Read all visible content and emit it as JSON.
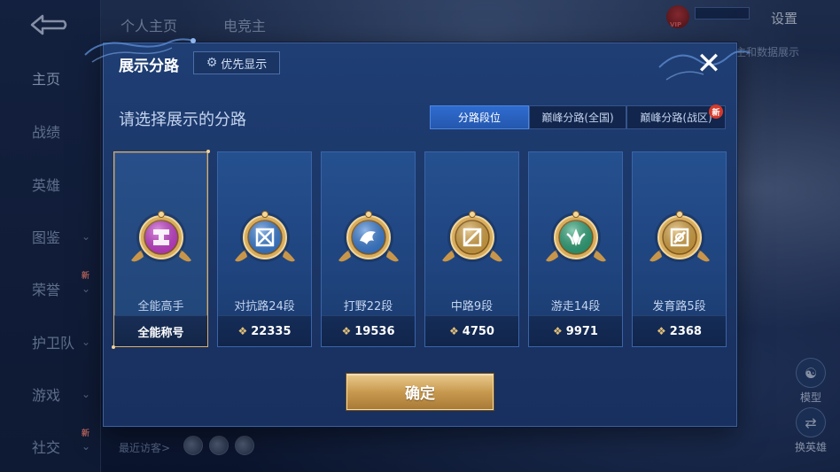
{
  "sidebar": {
    "items": [
      {
        "label": "主页",
        "chevron": false,
        "is_new": false
      },
      {
        "label": "战绩",
        "chevron": false,
        "is_new": false
      },
      {
        "label": "英雄",
        "chevron": false,
        "is_new": false
      },
      {
        "label": "图鉴",
        "chevron": true,
        "is_new": false
      },
      {
        "label": "荣誉",
        "chevron": true,
        "is_new": true
      },
      {
        "label": "护卫队",
        "chevron": true,
        "is_new": false
      },
      {
        "label": "游戏",
        "chevron": true,
        "is_new": false
      },
      {
        "label": "社交",
        "chevron": true,
        "is_new": true
      }
    ],
    "active_index": 0,
    "new_tag": "新"
  },
  "background": {
    "tab_personal": "个人主页",
    "tab_esports": "电竞主",
    "vip": "VIP",
    "settings": "设置",
    "right_text": "主和数据展示",
    "recent_visitors": "最近访客>",
    "model_label": "模型",
    "switch_hero_label": "换英雄"
  },
  "modal": {
    "title": "展示分路",
    "priority_button": "优先显示",
    "subtitle": "请选择展示的分路",
    "segments": [
      "分路段位",
      "巅峰分路(全国)",
      "巅峰分路(战区)"
    ],
    "active_segment": 0,
    "segment_new_tag": "新",
    "confirm": "确定"
  },
  "routes": [
    {
      "rank": "全能高手",
      "footer": "全能称号",
      "show_points_icon": false,
      "selected": true,
      "badge_icon": "all-round-master-icon",
      "badge_color": "#c93fd0"
    },
    {
      "rank": "对抗路24段",
      "footer": "22335",
      "show_points_icon": true,
      "selected": false,
      "badge_icon": "clash-lane-icon",
      "badge_color": "#3a7fd8"
    },
    {
      "rank": "打野22段",
      "footer": "19536",
      "show_points_icon": true,
      "selected": false,
      "badge_icon": "jungle-icon",
      "badge_color": "#3a7fd8"
    },
    {
      "rank": "中路9段",
      "footer": "4750",
      "show_points_icon": true,
      "selected": false,
      "badge_icon": "mid-lane-icon",
      "badge_color": "#d9a543"
    },
    {
      "rank": "游走14段",
      "footer": "9971",
      "show_points_icon": true,
      "selected": false,
      "badge_icon": "roam-icon",
      "badge_color": "#2ea57a"
    },
    {
      "rank": "发育路5段",
      "footer": "2368",
      "show_points_icon": true,
      "selected": false,
      "badge_icon": "farm-lane-icon",
      "badge_color": "#d9a543"
    }
  ]
}
